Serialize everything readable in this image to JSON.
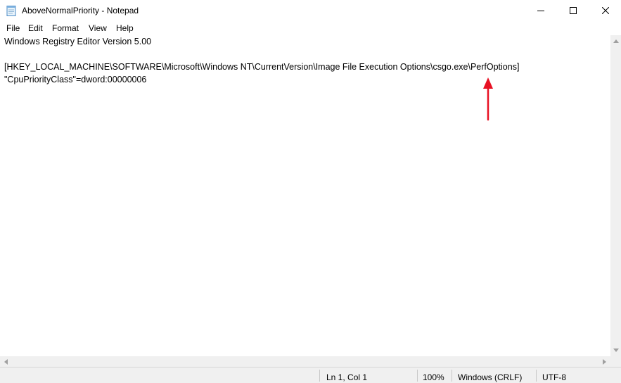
{
  "window": {
    "title": "AboveNormalPriority - Notepad",
    "icon": "notepad-icon"
  },
  "menu": {
    "items": [
      "File",
      "Edit",
      "Format",
      "View",
      "Help"
    ]
  },
  "document": {
    "lines": [
      "Windows Registry Editor Version 5.00",
      "",
      "[HKEY_LOCAL_MACHINE\\SOFTWARE\\Microsoft\\Windows NT\\CurrentVersion\\Image File Execution Options\\csgo.exe\\PerfOptions]",
      "\"CpuPriorityClass\"=dword:00000006"
    ]
  },
  "status": {
    "position": "Ln 1, Col 1",
    "zoom": "100%",
    "line_ending": "Windows (CRLF)",
    "encoding": "UTF-8"
  },
  "colors": {
    "annotation_arrow": "#e81123"
  }
}
